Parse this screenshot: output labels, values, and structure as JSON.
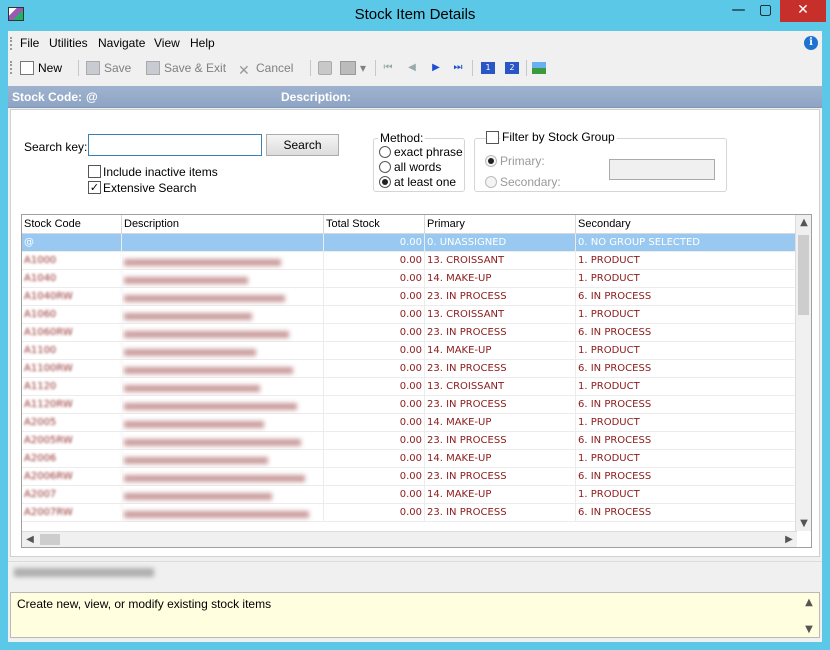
{
  "window": {
    "title": "Stock Item Details"
  },
  "menu": [
    "File",
    "Utilities",
    "Navigate",
    "View",
    "Help"
  ],
  "toolbar": {
    "new": "New",
    "save": "Save",
    "save_exit": "Save & Exit",
    "cancel": "Cancel"
  },
  "header": {
    "stock_code_label": "Stock Code:",
    "stock_code_value": "@",
    "description_label": "Description:"
  },
  "search": {
    "key_label": "Search key:",
    "value": "",
    "button": "Search",
    "include_inactive": "Include inactive items",
    "extensive": "Extensive Search"
  },
  "method": {
    "title": "Method:",
    "options": [
      "exact phrase",
      "all words",
      "at least one"
    ],
    "selected": "at least one"
  },
  "filter": {
    "title": "Filter by Stock Group",
    "primary_label": "Primary:",
    "secondary_label": "Secondary:"
  },
  "grid": {
    "columns": [
      "Stock Code",
      "Description",
      "Total Stock",
      "Primary",
      "Secondary"
    ],
    "rows": [
      [
        "@",
        "",
        "0.00",
        "0. UNASSIGNED",
        "0. NO GROUP SELECTED"
      ],
      [
        "A1000",
        "",
        "0.00",
        "13. CROISSANT",
        "1. PRODUCT"
      ],
      [
        "A1040",
        "",
        "0.00",
        "14. MAKE-UP",
        "1. PRODUCT"
      ],
      [
        "A1040RW",
        "",
        "0.00",
        "23. IN PROCESS",
        "6. IN PROCESS"
      ],
      [
        "A1060",
        "",
        "0.00",
        "13. CROISSANT",
        "1. PRODUCT"
      ],
      [
        "A1060RW",
        "",
        "0.00",
        "23. IN PROCESS",
        "6. IN PROCESS"
      ],
      [
        "A1100",
        "",
        "0.00",
        "14. MAKE-UP",
        "1. PRODUCT"
      ],
      [
        "A1100RW",
        "",
        "0.00",
        "23. IN PROCESS",
        "6. IN PROCESS"
      ],
      [
        "A1120",
        "",
        "0.00",
        "13. CROISSANT",
        "1. PRODUCT"
      ],
      [
        "A1120RW",
        "",
        "0.00",
        "23. IN PROCESS",
        "6. IN PROCESS"
      ],
      [
        "A2005",
        "",
        "0.00",
        "14. MAKE-UP",
        "1. PRODUCT"
      ],
      [
        "A2005RW",
        "",
        "0.00",
        "23. IN PROCESS",
        "6. IN PROCESS"
      ],
      [
        "A2006",
        "",
        "0.00",
        "14. MAKE-UP",
        "1. PRODUCT"
      ],
      [
        "A2006RW",
        "",
        "0.00",
        "23. IN PROCESS",
        "6. IN PROCESS"
      ],
      [
        "A2007",
        "",
        "0.00",
        "14. MAKE-UP",
        "1. PRODUCT"
      ],
      [
        "A2007RW",
        "",
        "0.00",
        "23. IN PROCESS",
        "6. IN PROCESS"
      ]
    ]
  },
  "help_text": "Create new, view, or modify existing stock items"
}
